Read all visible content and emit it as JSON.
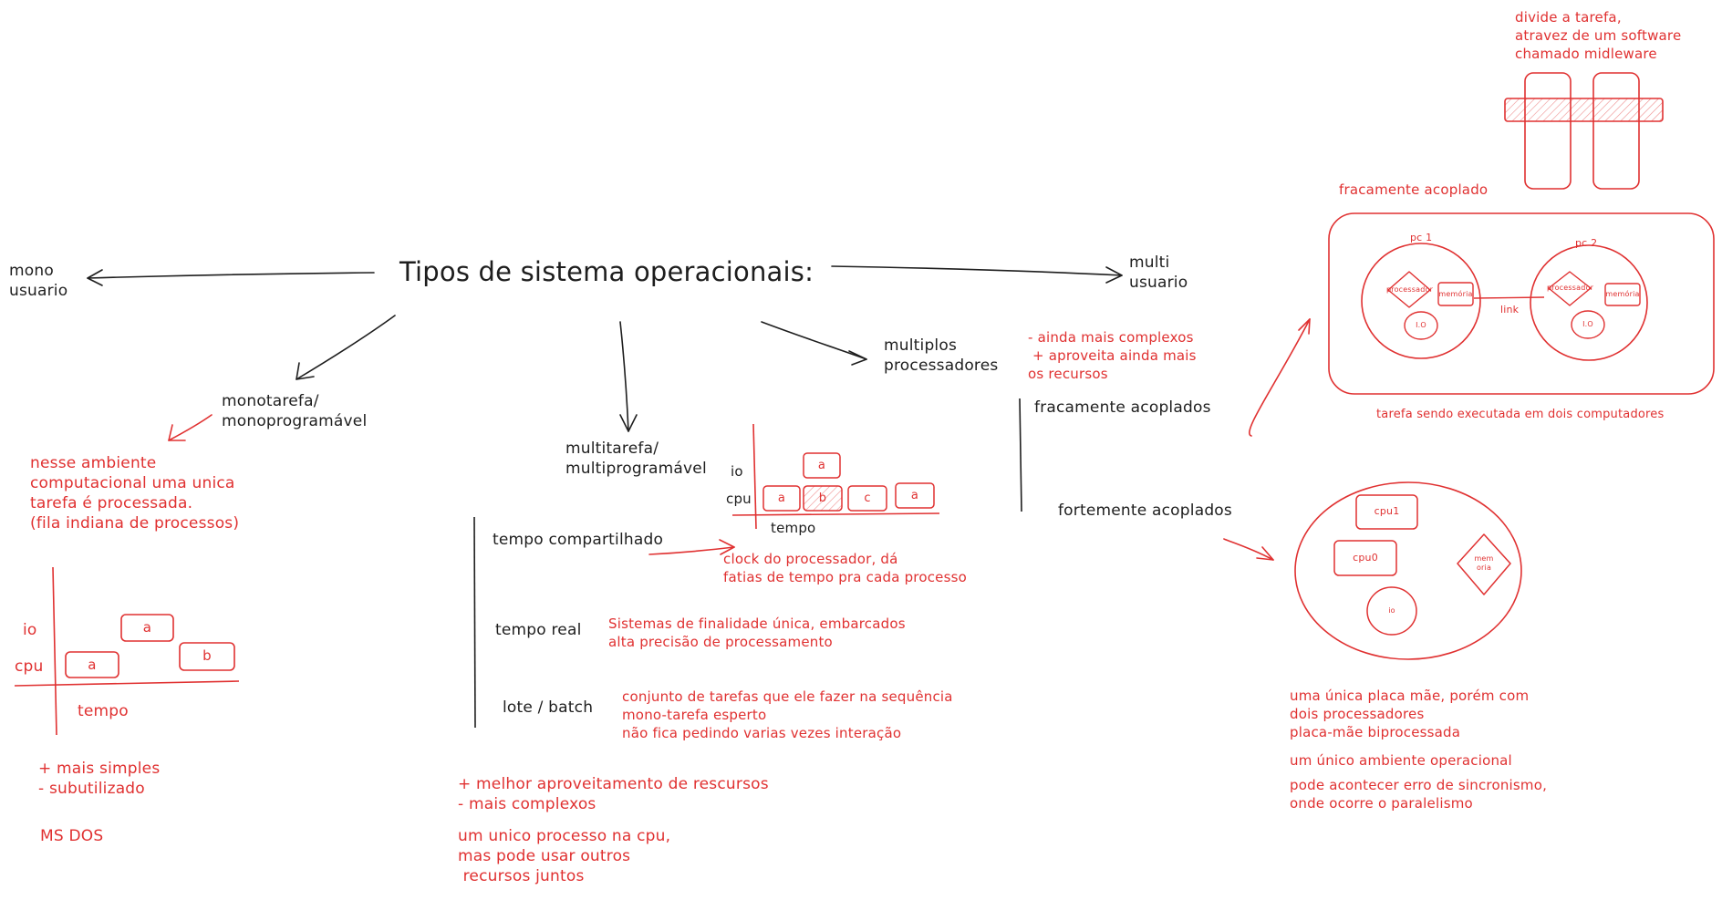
{
  "colors": {
    "ink": "#1e1e1e",
    "accent": "#e03131",
    "background": "#ffffff"
  },
  "title": "Tipos de sistema operacionais:",
  "mono_usuario": "mono\nusuario",
  "multi_usuario": "multi\nusuario",
  "monotarefa": {
    "label": "monotarefa/\nmonoprogramável",
    "description": "nesse ambiente\ncomputacional uma unica\ntarefa é processada.\n(fila indiana de processos)",
    "chart": {
      "row_labels": [
        "io",
        "cpu"
      ],
      "axis_label": "tempo",
      "blocks": [
        {
          "row": "cpu",
          "label": "a"
        },
        {
          "row": "io",
          "label": "a"
        },
        {
          "row": "cpu",
          "label": "b"
        }
      ]
    },
    "pros_cons": "+ mais simples\n- subutilizado",
    "example": "MS DOS"
  },
  "multitarefa": {
    "label": "multitarefa/\nmultiprogramável",
    "chart": {
      "row_labels": [
        "io",
        "cpu"
      ],
      "axis_label": "tempo",
      "io_block": "a",
      "cpu_blocks": [
        "a",
        "b",
        "c",
        "a"
      ]
    },
    "tempo_compartilhado": "tempo compartilhado",
    "tempo_compartilhado_note": "clock do processador, dá\nfatias de tempo pra cada processo",
    "tempo_real": "tempo real",
    "tempo_real_note": "Sistemas de finalidade única, embarcados\nalta precisão de processamento",
    "lote": "lote / batch",
    "lote_note": "conjunto de tarefas que ele fazer na sequência\nmono-tarefa esperto\nnão fica pedindo varias vezes interação",
    "pros_cons": "+ melhor aproveitamento de rescursos\n- mais complexos",
    "summary": "um unico processo na cpu,\nmas pode usar outros\n recursos juntos"
  },
  "multiplos": {
    "label": "multiplos\nprocessadores",
    "notes": "- ainda mais complexos\n + aproveita ainda mais\nos recursos",
    "fracamente": "fracamente acoplados",
    "fortemente": "fortemente acoplados"
  },
  "fracamente_diagram": {
    "middleware_note": "divide a tarefa,\natravez de um software\nchamado midleware",
    "title": "fracamente acoplado",
    "pc1": "pc 1",
    "pc2": "pc 2",
    "processador": "processador",
    "memoria": "memória",
    "io": "I.O",
    "link": "link",
    "caption": "tarefa sendo executada em dois computadores"
  },
  "fortemente_diagram": {
    "cpu1": "cpu1",
    "cpu0": "cpu0",
    "memoria": "mem\noria",
    "io": "io",
    "caption": "uma única placa mãe, porém com\ndois processadores\nplaca-mãe biprocessada",
    "note1": "um único ambiente operacional",
    "note2": "pode acontecer erro de sincronismo,\nonde ocorre o paralelismo"
  }
}
